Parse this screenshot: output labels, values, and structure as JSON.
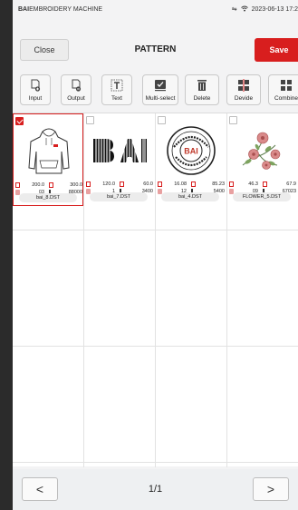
{
  "status": {
    "brand": "BAI",
    "brand_suffix": " EMBROIDERY MACHINE",
    "datetime": "2023-06-13 17:2"
  },
  "header": {
    "close_label": "Close",
    "title": "PATTERN",
    "save_label": "Save"
  },
  "toolbar": {
    "input": "Input",
    "output": "Output",
    "text": "Text",
    "multiselect": "Multi-select",
    "delete": "Delete",
    "devide": "Devide",
    "combine": "Combine"
  },
  "patterns": [
    {
      "name": "bai_8.DST",
      "width": "200.0",
      "height": "300.0",
      "colors": "03",
      "stitches": "88000",
      "selected": true,
      "icon": "hoodie-design-thumbnail"
    },
    {
      "name": "bai_7.DST",
      "width": "120.0",
      "height": "60.0",
      "colors": "1",
      "stitches": "3400",
      "selected": false,
      "icon": "bai-logo-thumbnail"
    },
    {
      "name": "bai_4.DST",
      "width": "16.08",
      "height": "85.23",
      "colors": "12",
      "stitches": "5400",
      "selected": false,
      "icon": "embroidery-machine-badge-thumbnail"
    },
    {
      "name": "FLOWER_5.DST",
      "width": "46.3",
      "height": "67.9",
      "colors": "09",
      "stitches": "67023",
      "selected": false,
      "icon": "flower-thumbnail"
    }
  ],
  "pager": {
    "page": "1/1",
    "prev": "<",
    "next": ">"
  },
  "colors": {
    "accent": "#d81e1e",
    "frame": "#2b2b2b",
    "background": "#f3f3f4"
  }
}
